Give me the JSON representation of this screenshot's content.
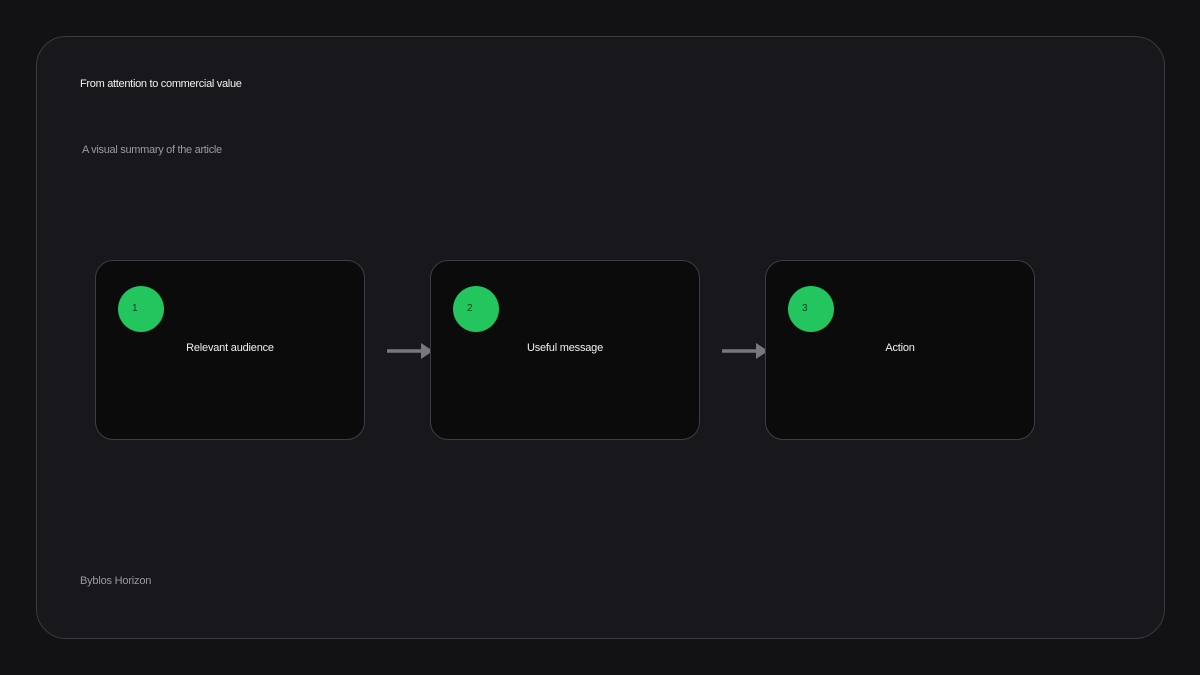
{
  "diagram": {
    "title": "From attention to commercial value",
    "subtitle": "A visual summary of the article",
    "footer": "Byblos Horizon",
    "steps": [
      {
        "number": "1",
        "label": "Relevant audience"
      },
      {
        "number": "2",
        "label": "Useful message"
      },
      {
        "number": "3",
        "label": "Action"
      }
    ]
  },
  "colors": {
    "background": "#121214",
    "panel": "#18181c",
    "card": "#0b0b0c",
    "accent": "#22c55e",
    "arrow": "#77777c"
  }
}
